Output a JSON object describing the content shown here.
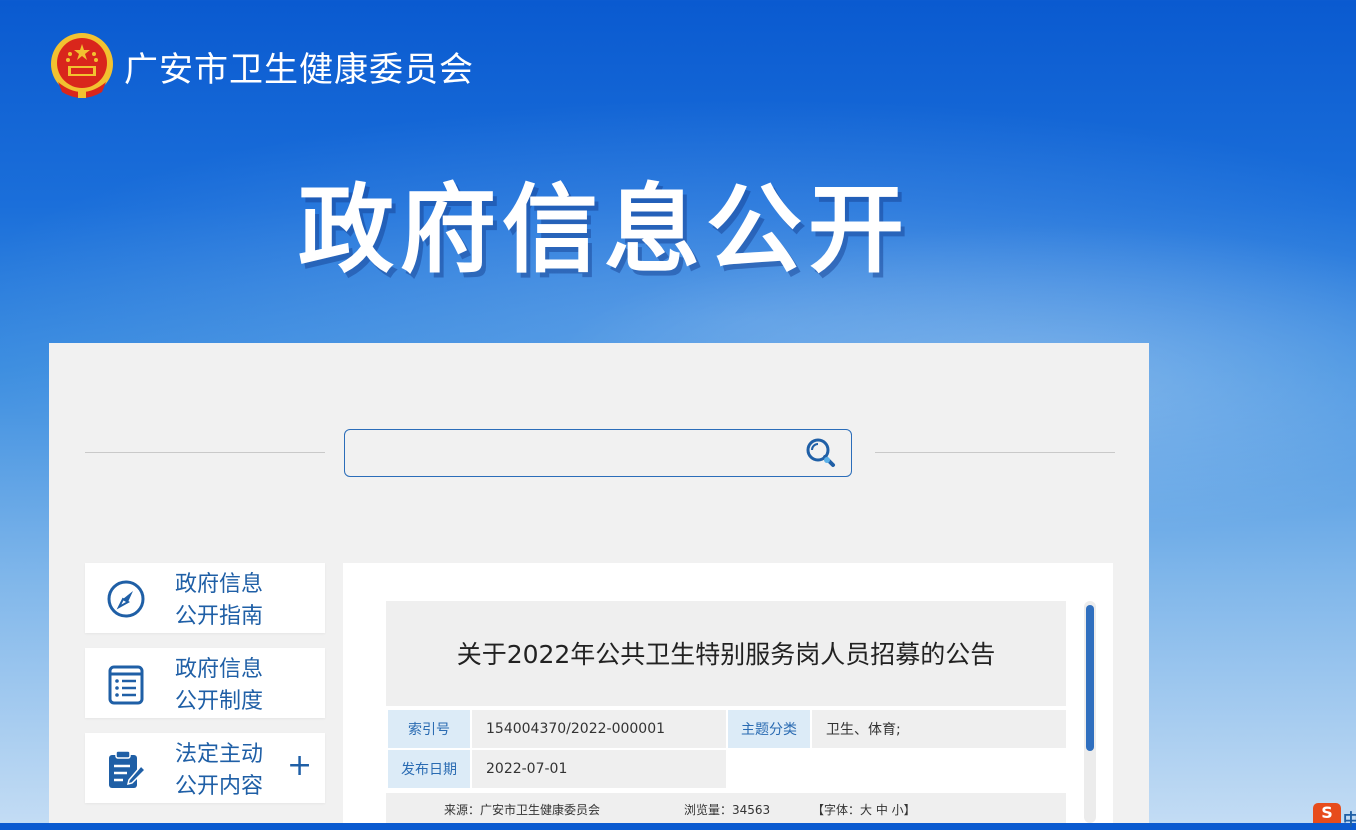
{
  "header": {
    "site_title": "广安市卫生健康委员会",
    "emblem_icon": "national-emblem-icon"
  },
  "banner": {
    "title": "政府信息公开"
  },
  "search": {
    "value": "",
    "placeholder": "",
    "button_icon": "search-icon"
  },
  "sidebar": {
    "items": [
      {
        "label": "政府信息公开指南",
        "line1": "政府信息",
        "line2": "公开指南",
        "icon": "compass-icon",
        "has_plus": false
      },
      {
        "label": "政府信息公开制度",
        "line1": "政府信息",
        "line2": "公开制度",
        "icon": "list-document-icon",
        "has_plus": false
      },
      {
        "label": "法定主动公开内容",
        "line1": "法定主动",
        "line2": "公开内容",
        "icon": "clipboard-pen-icon",
        "has_plus": true,
        "plus": "+"
      }
    ]
  },
  "article": {
    "title": "关于2022年公共卫生特别服务岗人员招募的公告",
    "meta": {
      "index_label": "索引号",
      "index_value": "154004370/2022-000001",
      "topic_label": "主题分类",
      "topic_value": "卫生、体育;",
      "date_label": "发布日期",
      "date_value": "2022-07-01"
    },
    "source_line": {
      "source": "来源：广安市卫生健康委员会",
      "views": "浏览量：34563",
      "font_size": "【字体：大 中 小】"
    }
  },
  "ime": {
    "logo": "S",
    "text": "中"
  },
  "colors": {
    "brand_blue": "#1f5fa6",
    "accent_blue": "#2f6fbf",
    "label_bg": "#dcebf7",
    "emblem_red": "#d9261c",
    "emblem_gold": "#f2c230"
  }
}
